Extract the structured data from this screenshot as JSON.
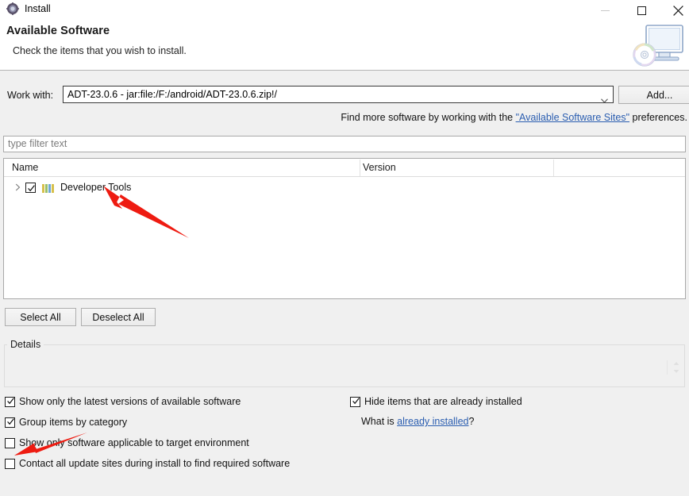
{
  "window": {
    "title": "Install",
    "icon": "install-gear-icon",
    "controls": {
      "minimize": "minimize-icon",
      "maximize": "maximize-icon",
      "close": "close-icon"
    }
  },
  "header": {
    "title": "Available Software",
    "subtitle": "Check the items that you wish to install.",
    "artwork": "computer-cd-icon"
  },
  "work_with": {
    "label": "Work with:",
    "value": "ADT-23.0.6 - jar:file:/F:/android/ADT-23.0.6.zip!/",
    "dropdown_icon": "chevron-down-icon",
    "add_button": "Add..."
  },
  "find_more": {
    "prefix": "Find more software by working with the ",
    "link": "\"Available Software Sites\"",
    "suffix": " preferences."
  },
  "filter": {
    "placeholder": "type filter text",
    "value": ""
  },
  "tree": {
    "columns": [
      "Name",
      "Version"
    ],
    "rows": [
      {
        "name": "Developer Tools",
        "version": "",
        "checked": true,
        "expandable": true,
        "expanded": false,
        "icon": "category-bars-icon"
      }
    ]
  },
  "buttons": {
    "select_all": "Select All",
    "deselect_all": "Deselect All"
  },
  "details": {
    "legend": "Details",
    "content": "",
    "spinner_icon": "up-down-spinner-icon"
  },
  "options": {
    "left": [
      {
        "label": "Show only the latest versions of available software",
        "checked": true
      },
      {
        "label": "Group items by category",
        "checked": true
      },
      {
        "label": "Show only software applicable to target environment",
        "checked": false
      },
      {
        "label": "Contact all update sites during install to find required software",
        "checked": false
      }
    ],
    "right": [
      {
        "label": "Hide items that are already installed",
        "checked": true
      }
    ],
    "what_is": {
      "prefix": "What is ",
      "link": "already installed",
      "suffix": "?"
    }
  },
  "annotations": [
    {
      "name": "arrow-pointing-to-developer-tools",
      "color": "#ee1b11"
    },
    {
      "name": "arrow-pointing-to-checkbox-options",
      "color": "#ee1b11"
    }
  ],
  "colors": {
    "link": "#2a5db0",
    "annotation": "#ee1b11",
    "dialog_bg": "#f0f0f0",
    "header_bg": "#ffffff"
  }
}
